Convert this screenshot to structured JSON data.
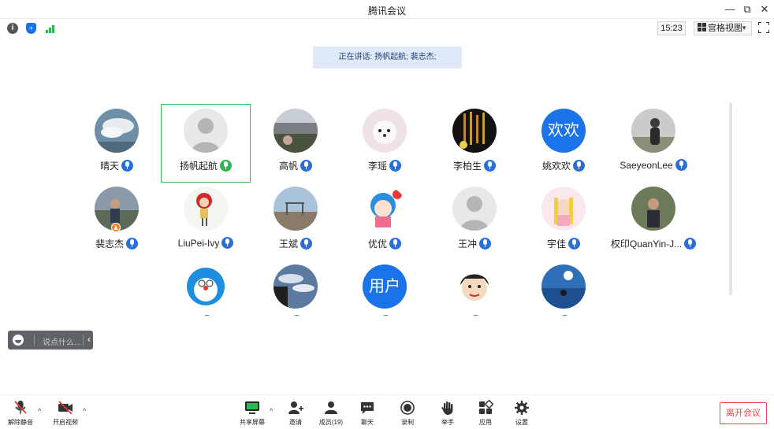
{
  "window": {
    "title": "腾讯会议"
  },
  "topbar": {
    "time": "15:23",
    "view_label": "宫格视图"
  },
  "speaking": {
    "text": "正在讲话: 扬帆起航; 裴志杰;"
  },
  "participants": [
    {
      "name": "晴天"
    },
    {
      "name": "扬帆起航"
    },
    {
      "name": "高帆"
    },
    {
      "name": "李瑶"
    },
    {
      "name": "李柏生"
    },
    {
      "name": "姚欢欢",
      "avatar_text": "欢欢"
    },
    {
      "name": "SaeyeonLee"
    },
    {
      "name": "裴志杰"
    },
    {
      "name": "LiuPei-Ivy"
    },
    {
      "name": "王斌"
    },
    {
      "name": "优优"
    },
    {
      "name": "王冲"
    },
    {
      "name": "宇佳"
    },
    {
      "name": "权印QuanYin-J..."
    },
    {
      "name": ""
    },
    {
      "name": ""
    },
    {
      "name": "",
      "avatar_text": "用户"
    },
    {
      "name": ""
    },
    {
      "name": ""
    }
  ],
  "chat_quick": {
    "placeholder": "说点什么..."
  },
  "toolbar": {
    "unmute": "解除静音",
    "start_video": "开启视频",
    "share_screen": "共享屏幕",
    "invite": "邀请",
    "members": "成员(19)",
    "chat": "聊天",
    "record": "录制",
    "raise_hand": "举手",
    "apps": "应用",
    "settings": "设置",
    "leave": "离开会议"
  },
  "colors": {
    "accent": "#1a73e8",
    "speaking_green": "#33c04c",
    "leave_red": "#e5484d"
  }
}
